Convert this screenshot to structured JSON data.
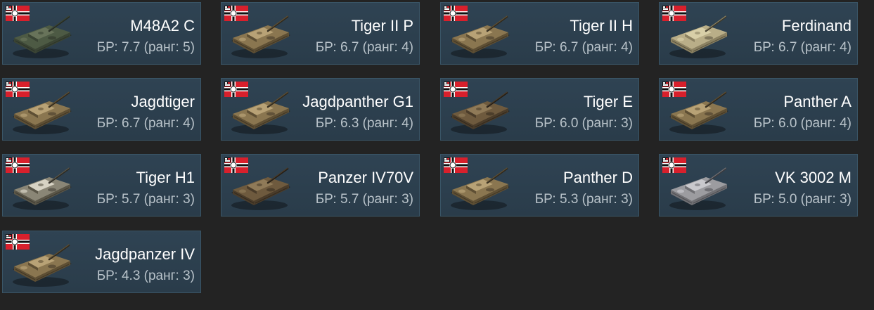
{
  "colors": {
    "background": "#232323",
    "card_bg": "#2d4150",
    "card_border": "#3a5566",
    "name_text": "#ffffff",
    "br_text": "#b9c3ca",
    "flag_red": "#d8202c"
  },
  "icons": {
    "flag": "german-war-flag-icon",
    "tank": "tank-thumbnail-icon"
  },
  "vehicles": [
    {
      "name": "M48A2 C",
      "br_label": "БР: 7.7 (ранг: 5)",
      "camo": "green"
    },
    {
      "name": "Tiger II P",
      "br_label": "БР: 6.7 (ранг: 4)",
      "camo": "tan"
    },
    {
      "name": "Tiger II H",
      "br_label": "БР: 6.7 (ранг: 4)",
      "camo": "tan"
    },
    {
      "name": "Ferdinand",
      "br_label": "БР: 6.7 (ранг: 4)",
      "camo": "sand"
    },
    {
      "name": "Jagdtiger",
      "br_label": "БР: 6.7 (ранг: 4)",
      "camo": "tan"
    },
    {
      "name": "Jagdpanther G1",
      "br_label": "БР: 6.3 (ранг: 4)",
      "camo": "tan"
    },
    {
      "name": "Tiger E",
      "br_label": "БР: 6.0 (ранг: 3)",
      "camo": "brown"
    },
    {
      "name": "Panther A",
      "br_label": "БР: 6.0 (ранг: 4)",
      "camo": "tan"
    },
    {
      "name": "Tiger H1",
      "br_label": "БР: 5.7 (ранг: 3)",
      "camo": "winter"
    },
    {
      "name": "Panzer IV70V",
      "br_label": "БР: 5.7 (ранг: 3)",
      "camo": "brown"
    },
    {
      "name": "Panther D",
      "br_label": "БР: 5.3 (ранг: 3)",
      "camo": "tan"
    },
    {
      "name": "VK 3002 M",
      "br_label": "БР: 5.0 (ранг: 3)",
      "camo": "grey"
    },
    {
      "name": "Jagdpanzer IV",
      "br_label": "БР: 4.3 (ранг: 3)",
      "camo": "tan"
    }
  ]
}
